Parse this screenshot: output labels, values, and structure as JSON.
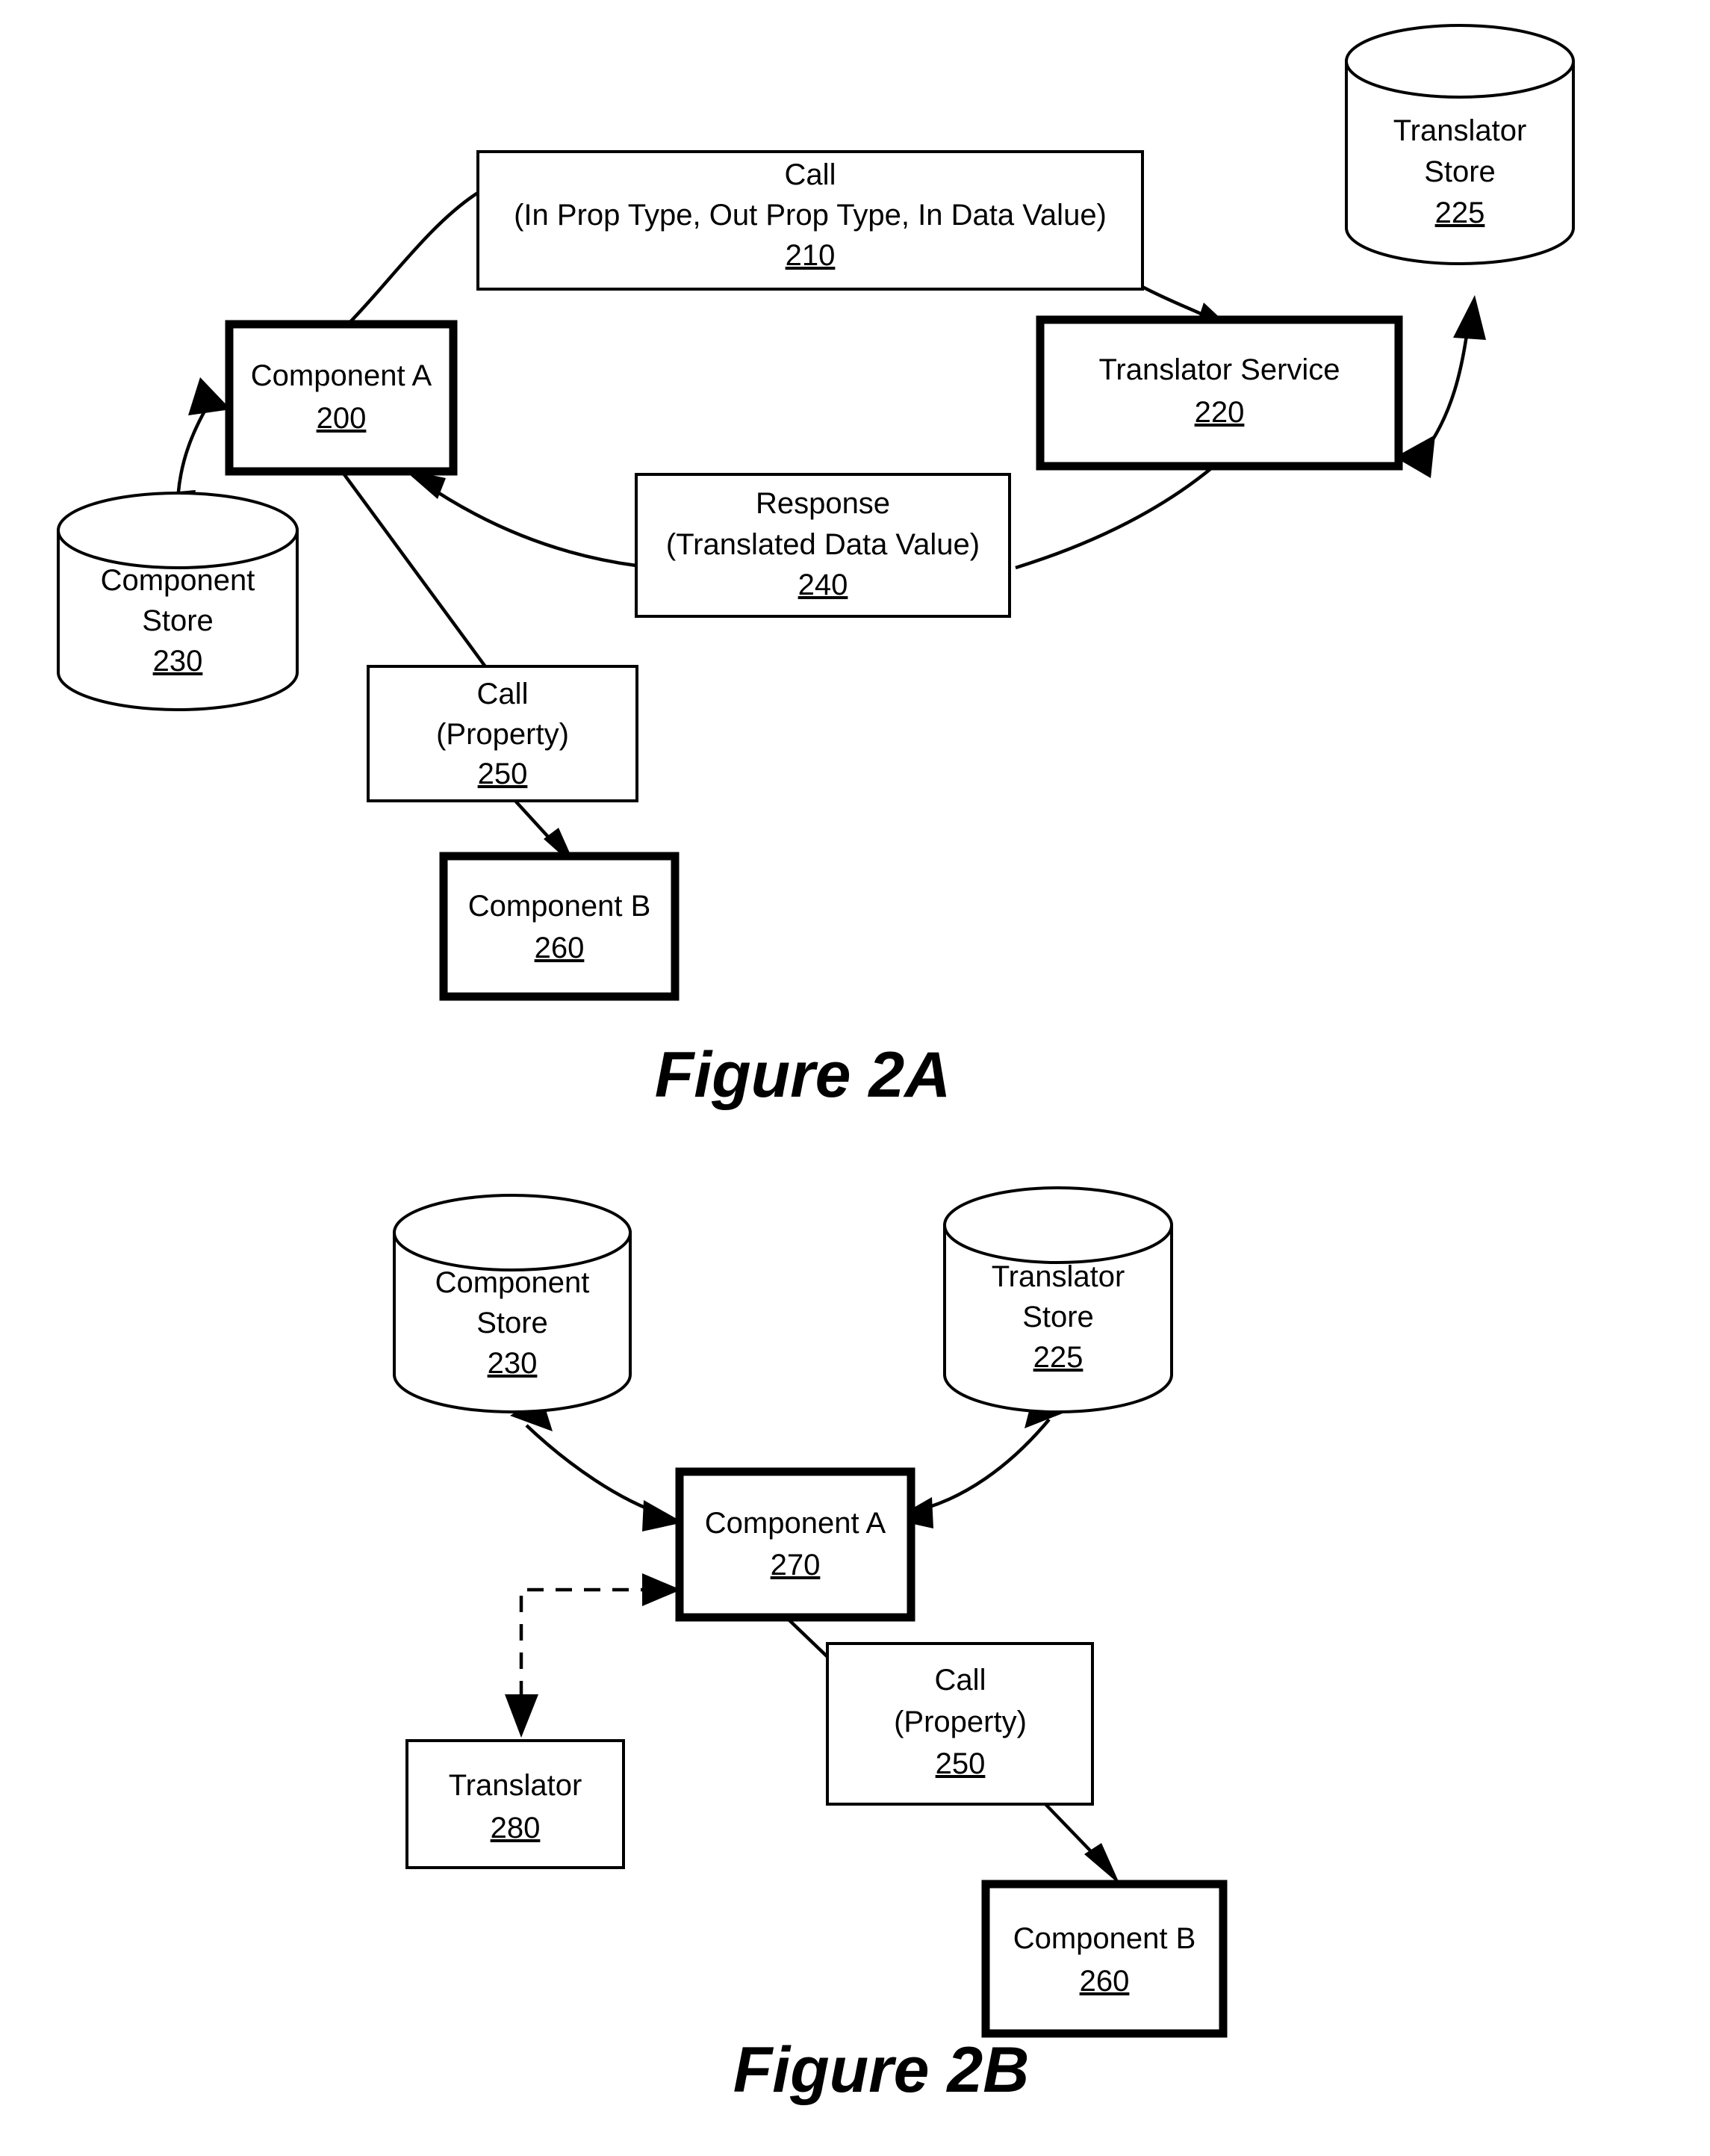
{
  "sheet": {
    "background_color": "#ffffff",
    "ink_color": "#000000"
  },
  "figures": [
    {
      "id": "figure-2a",
      "caption": "Figure 2A",
      "nodes": [
        {
          "key": "call_210",
          "shape": "box",
          "emphasis": "thin",
          "label_lines": [
            "Call",
            "(In Prop Type, Out Prop Type, In Data Value)"
          ],
          "ref": "210"
        },
        {
          "key": "component_a_200",
          "shape": "box",
          "emphasis": "thick",
          "label_lines": [
            "Component A"
          ],
          "ref": "200"
        },
        {
          "key": "translator_service_220",
          "shape": "box",
          "emphasis": "thick",
          "label_lines": [
            "Translator Service"
          ],
          "ref": "220"
        },
        {
          "key": "translator_store_225",
          "shape": "cylinder",
          "emphasis": "thin",
          "label_lines": [
            "Translator",
            "Store"
          ],
          "ref": "225"
        },
        {
          "key": "component_store_230",
          "shape": "cylinder",
          "emphasis": "thin",
          "label_lines": [
            "Component",
            "Store"
          ],
          "ref": "230"
        },
        {
          "key": "response_240",
          "shape": "box",
          "emphasis": "thin",
          "label_lines": [
            "Response",
            "(Translated Data Value)"
          ],
          "ref": "240"
        },
        {
          "key": "call_250",
          "shape": "box",
          "emphasis": "thin",
          "label_lines": [
            "Call",
            "(Property)"
          ],
          "ref": "250"
        },
        {
          "key": "component_b_260",
          "shape": "box",
          "emphasis": "thick",
          "label_lines": [
            "Component B"
          ],
          "ref": "260"
        }
      ],
      "connections": [
        {
          "from": "component_a_200",
          "to": "call_210",
          "style": "solid",
          "arrows": "none"
        },
        {
          "from": "call_210",
          "to": "translator_service_220",
          "style": "solid",
          "arrows": "end"
        },
        {
          "from": "translator_service_220",
          "to": "translator_store_225",
          "style": "solid",
          "arrows": "both"
        },
        {
          "from": "component_a_200",
          "to": "component_store_230",
          "style": "solid",
          "arrows": "both"
        },
        {
          "from": "translator_service_220",
          "to": "response_240",
          "style": "solid",
          "arrows": "none"
        },
        {
          "from": "response_240",
          "to": "component_a_200",
          "style": "solid",
          "arrows": "end"
        },
        {
          "from": "component_a_200",
          "to": "call_250",
          "style": "solid",
          "arrows": "none"
        },
        {
          "from": "call_250",
          "to": "component_b_260",
          "style": "solid",
          "arrows": "end"
        }
      ]
    },
    {
      "id": "figure-2b",
      "caption": "Figure 2B",
      "nodes": [
        {
          "key": "component_store_230b",
          "shape": "cylinder",
          "emphasis": "thin",
          "label_lines": [
            "Component",
            "Store"
          ],
          "ref": "230"
        },
        {
          "key": "translator_store_225b",
          "shape": "cylinder",
          "emphasis": "thin",
          "label_lines": [
            "Translator",
            "Store"
          ],
          "ref": "225"
        },
        {
          "key": "component_a_270",
          "shape": "box",
          "emphasis": "thick",
          "label_lines": [
            "Component A"
          ],
          "ref": "270"
        },
        {
          "key": "translator_280",
          "shape": "box",
          "emphasis": "thin",
          "label_lines": [
            "Translator"
          ],
          "ref": "280"
        },
        {
          "key": "call_250b",
          "shape": "box",
          "emphasis": "thin",
          "label_lines": [
            "Call",
            "(Property)"
          ],
          "ref": "250"
        },
        {
          "key": "component_b_260b",
          "shape": "box",
          "emphasis": "thick",
          "label_lines": [
            "Component B"
          ],
          "ref": "260"
        }
      ],
      "connections": [
        {
          "from": "component_a_270",
          "to": "component_store_230b",
          "style": "solid",
          "arrows": "both"
        },
        {
          "from": "component_a_270",
          "to": "translator_store_225b",
          "style": "solid",
          "arrows": "both"
        },
        {
          "from": "component_a_270",
          "to": "translator_280",
          "style": "dashed",
          "arrows": "end"
        },
        {
          "from": "component_a_270",
          "to": "call_250b",
          "style": "solid",
          "arrows": "none"
        },
        {
          "from": "call_250b",
          "to": "component_b_260b",
          "style": "solid",
          "arrows": "end"
        }
      ]
    }
  ],
  "labels": {
    "call_210_line1": "Call",
    "call_210_line2": "(In Prop Type, Out Prop Type, In Data Value)",
    "call_210_ref": "210",
    "component_a_200_line1": "Component A",
    "component_a_200_ref": "200",
    "translator_service_220_line1": "Translator Service",
    "translator_service_220_ref": "220",
    "translator_store_225_line1": "Translator",
    "translator_store_225_line2": "Store",
    "translator_store_225_ref": "225",
    "component_store_230_line1": "Component",
    "component_store_230_line2": "Store",
    "component_store_230_ref": "230",
    "response_240_line1": "Response",
    "response_240_line2": "(Translated Data Value)",
    "response_240_ref": "240",
    "call_250_line1": "Call",
    "call_250_line2": "(Property)",
    "call_250_ref": "250",
    "component_b_260_line1": "Component B",
    "component_b_260_ref": "260",
    "figure_2a_caption": "Figure 2A",
    "component_store_230b_line1": "Component",
    "component_store_230b_line2": "Store",
    "component_store_230b_ref": "230",
    "translator_store_225b_line1": "Translator",
    "translator_store_225b_line2": "Store",
    "translator_store_225b_ref": "225",
    "component_a_270_line1": "Component A",
    "component_a_270_ref": "270",
    "translator_280_line1": "Translator",
    "translator_280_ref": "280",
    "call_250b_line1": "Call",
    "call_250b_line2": "(Property)",
    "call_250b_ref": "250",
    "component_b_260b_line1": "Component B",
    "component_b_260b_ref": "260",
    "figure_2b_caption": "Figure 2B"
  }
}
